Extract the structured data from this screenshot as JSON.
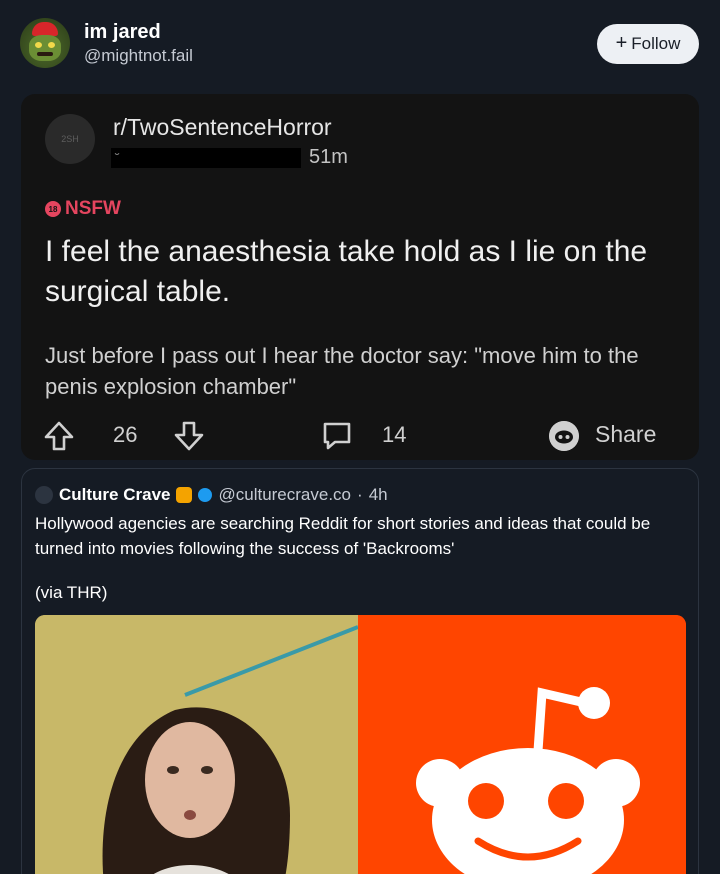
{
  "post": {
    "display_name": "im jared",
    "handle": "@mightnot.fail",
    "follow_label": "Follow"
  },
  "reddit": {
    "subreddit": "r/TwoSentenceHorror",
    "avatar_text": "2SH",
    "time_ago": "51m",
    "nsfw_label": "NSFW",
    "nsfw_icon_text": "18",
    "title": "I feel the anaesthesia take hold as I lie on the surgical table.",
    "body": "Just before I pass out I hear the doctor say: \"move him to the penis explosion chamber\"",
    "votes": "26",
    "comments": "14",
    "share_label": "Share"
  },
  "quote": {
    "name": "Culture Crave",
    "handle": "@culturecrave.co",
    "separator": "·",
    "time": "4h",
    "text": "Hollywood agencies are searching Reddit for short stories and ideas that could be turned into movies following the success of 'Backrooms'",
    "via": "(via THR)"
  },
  "colors": {
    "background": "#151b24",
    "reddit_card": "#131313",
    "nsfw": "#e5455f",
    "reddit_orange": "#ff4500",
    "verified": "#1d9bf0"
  },
  "icons": [
    "upvote-icon",
    "downvote-icon",
    "comment-icon",
    "share-icon",
    "plus-icon",
    "verified-icon",
    "popcorn-icon"
  ]
}
